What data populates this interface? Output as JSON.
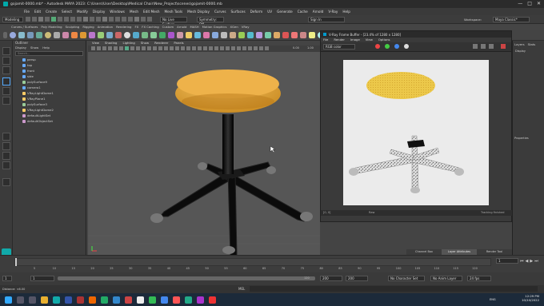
{
  "window": {
    "title": "gojamit-0000.mb* - Autodesk MAYA 2023: C:\\Users\\User\\Desktop\\Medical Chair\\New_Project\\scenes\\gojamit-0000.mb",
    "controls": [
      "—",
      "□",
      "✕"
    ]
  },
  "menubar": [
    "File",
    "Edit",
    "Create",
    "Select",
    "Modify",
    "Display",
    "Windows",
    "Mesh",
    "Edit Mesh",
    "Mesh Tools",
    "Mesh Display",
    "Curves",
    "Surfaces",
    "Deform",
    "UV",
    "Generate",
    "Cache",
    "Arnold",
    "V-Ray",
    "Help"
  ],
  "statusline": {
    "mode": "Modeling",
    "live_surface": "No Live Surface",
    "symmetry": "Symmetry: Off",
    "signin": "Sign In",
    "workspace_label": "Workspace:",
    "workspace_value": "Maya Classic*"
  },
  "shelf_tabs": [
    "Curves / Surfaces",
    "Poly Modeling",
    "Sculpting",
    "Rigging",
    "Animation",
    "Rendering",
    "FX",
    "FX Caching",
    "Custom",
    "Arnold",
    "MASH",
    "Motion Graphics",
    "XGen",
    "VRay"
  ],
  "outliner": {
    "title": "Outliner",
    "menu": [
      "Display",
      "Show",
      "Help"
    ],
    "search_placeholder": "Search...",
    "items": [
      "persp",
      "top",
      "front",
      "side",
      "polySurface9",
      "camera1",
      "VRayLightDome1",
      "VRayPlane1",
      "polySurface3",
      "VRayLightDome2",
      "defaultLightSet",
      "defaultObjectSet"
    ]
  },
  "viewport": {
    "menu": [
      "View",
      "Shading",
      "Lighting",
      "Show",
      "Renderer",
      "Panels"
    ],
    "camera_label": "camera1",
    "value1": "0.00",
    "value2": "1.00"
  },
  "vfb": {
    "title": "V-Ray Frame Buffer - [23.4% of 1280 x 1280]",
    "menu": [
      "File",
      "Render",
      "Image",
      "View",
      "Options"
    ],
    "channel": "RGB color",
    "status_left": "[0, 0]",
    "status_mid": "Raw",
    "status_right": "Tracking finished"
  },
  "right_panel": {
    "tabs": [
      "Layers",
      "Stats"
    ],
    "item1": "Display",
    "item2": "Properties"
  },
  "attr_panel": {
    "tab1": "Channel Box",
    "tab2": "Layer Attributes",
    "tab3": "Render Tool"
  },
  "timeline": {
    "ticks": [
      "5",
      "10",
      "15",
      "20",
      "25",
      "30",
      "35",
      "40",
      "45",
      "50",
      "55",
      "60",
      "65",
      "70",
      "75",
      "80",
      "85",
      "90",
      "95",
      "100",
      "105",
      "110",
      "115",
      "120"
    ],
    "current_frame": "1"
  },
  "range": {
    "start": "1",
    "start2": "1",
    "current": "1",
    "end": "120",
    "end2": "200",
    "end3": "200",
    "character_set": "No Character Set",
    "anim_layer": "No Anim Layer",
    "fps": "24 fps"
  },
  "cmdline": {
    "mel_label": "MEL",
    "status": "Distance: <6.00"
  },
  "taskbar": {
    "time": "12:29 PM",
    "date": "10/10/2022",
    "weather": "ENG"
  },
  "colors": {
    "seat": "#e8a83a",
    "seat_render": "#e8c84a",
    "stand": "#101010",
    "viewport_bg": "#565656",
    "render_bg": "#ebebeb"
  }
}
